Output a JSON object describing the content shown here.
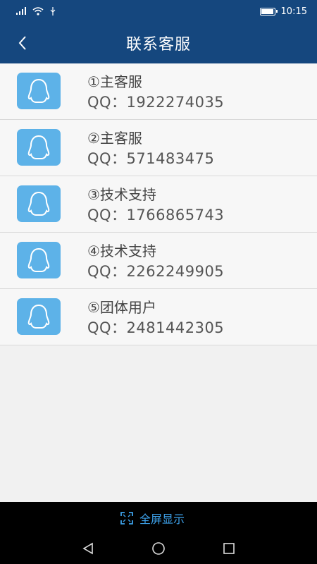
{
  "status_bar": {
    "time": "10:15"
  },
  "app_bar": {
    "title": "联系客服"
  },
  "contacts": [
    {
      "name": "①主客服",
      "qq": "QQ：1922274035"
    },
    {
      "name": "②主客服",
      "qq": "QQ：571483475"
    },
    {
      "name": "③技术支持",
      "qq": "QQ：1766865743"
    },
    {
      "name": "④技术支持",
      "qq": "QQ：2262249905"
    },
    {
      "name": "⑤团体用户",
      "qq": "QQ：2481442305"
    }
  ],
  "bottom": {
    "fullscreen_label": "全屏显示"
  },
  "colors": {
    "header": "#15477e",
    "avatar": "#5db2e8",
    "accent": "#3da0e8"
  },
  "icons": [
    "signal-icon",
    "wifi-icon",
    "usb-icon",
    "battery-icon",
    "back-icon",
    "qq-penguin-icon",
    "fullscreen-icon",
    "nav-back-icon",
    "nav-home-icon",
    "nav-recents-icon"
  ]
}
